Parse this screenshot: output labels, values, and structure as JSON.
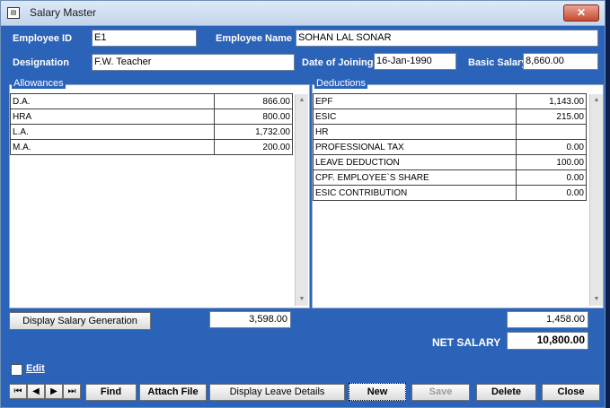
{
  "window": {
    "title": "Salary Master",
    "close_label": "✕"
  },
  "header": {
    "employee_id_label": "Employee ID",
    "employee_id": "E1",
    "employee_name_label": "Employee Name",
    "employee_name": "SOHAN LAL SONAR",
    "designation_label": "Designation",
    "designation": "F.W. Teacher",
    "date_of_joining_label": "Date of Joining",
    "date_of_joining": "16-Jan-1990",
    "basic_salary_label": "Basic Salary",
    "basic_salary": "8,660.00"
  },
  "allowances": {
    "title": "Allowances",
    "rows": [
      {
        "name": "D.A.",
        "amount": "866.00"
      },
      {
        "name": "HRA",
        "amount": "800.00"
      },
      {
        "name": "L.A.",
        "amount": "1,732.00"
      },
      {
        "name": "M.A.",
        "amount": "200.00"
      }
    ],
    "total": "3,598.00"
  },
  "deductions": {
    "title": "Deductions",
    "rows": [
      {
        "name": "EPF",
        "amount": "1,143.00"
      },
      {
        "name": "ESIC",
        "amount": "215.00"
      },
      {
        "name": "HR",
        "amount": ""
      },
      {
        "name": "PROFESSIONAL TAX",
        "amount": "0.00"
      },
      {
        "name": "LEAVE DEDUCTION",
        "amount": "100.00"
      },
      {
        "name": "CPF. EMPLOYEE`S SHARE",
        "amount": "0.00"
      },
      {
        "name": "ESIC CONTRIBUTION",
        "amount": "0.00"
      }
    ],
    "total": "1,458.00"
  },
  "display_salary_generation": "Display Salary Generation",
  "net_salary_label": "NET SALARY",
  "net_salary": "10,800.00",
  "edit_label": "Edit",
  "toolbar": {
    "find": "Find",
    "attach_file": "Attach File",
    "display_leave_details": "Display Leave Details",
    "new": "New",
    "save": "Save",
    "delete": "Delete",
    "close": "Close"
  }
}
